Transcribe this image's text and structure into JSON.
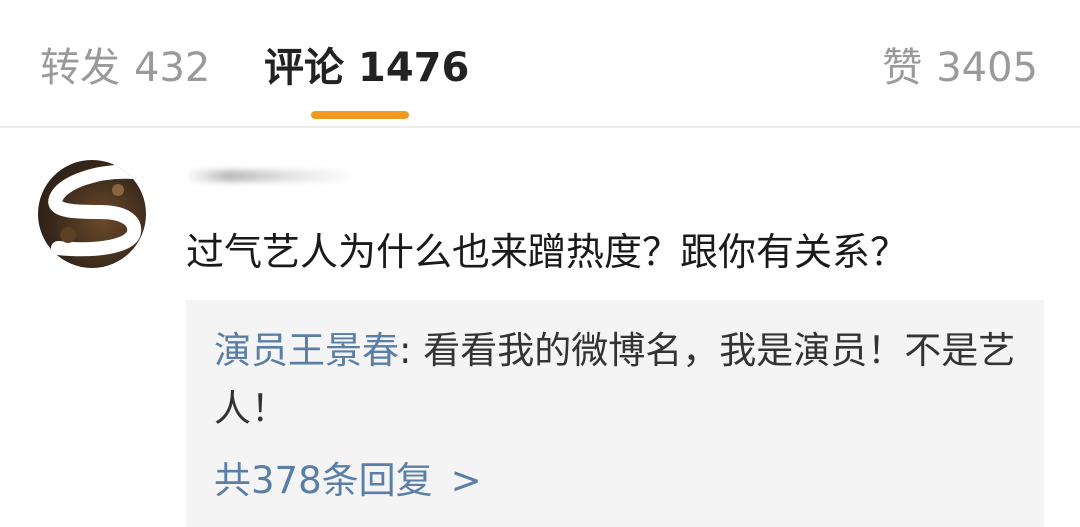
{
  "tabs": {
    "repost": {
      "label": "转发",
      "count": "432"
    },
    "comments": {
      "label": "评论",
      "count": "1476"
    },
    "likes": {
      "label": "赞",
      "count": "3405"
    }
  },
  "accent_color": "#f09a22",
  "link_color": "#5a7ea6",
  "comment": {
    "text": "过气艺人为什么也来蹭热度？跟你有关系？"
  },
  "reply": {
    "author": "演员王景春",
    "separator": ": ",
    "text": "看看我的微博名，我是演员！不是艺人！",
    "more_label": "共378条回复",
    "more_icon": "chevron-right-icon",
    "more_chevron": ">"
  }
}
